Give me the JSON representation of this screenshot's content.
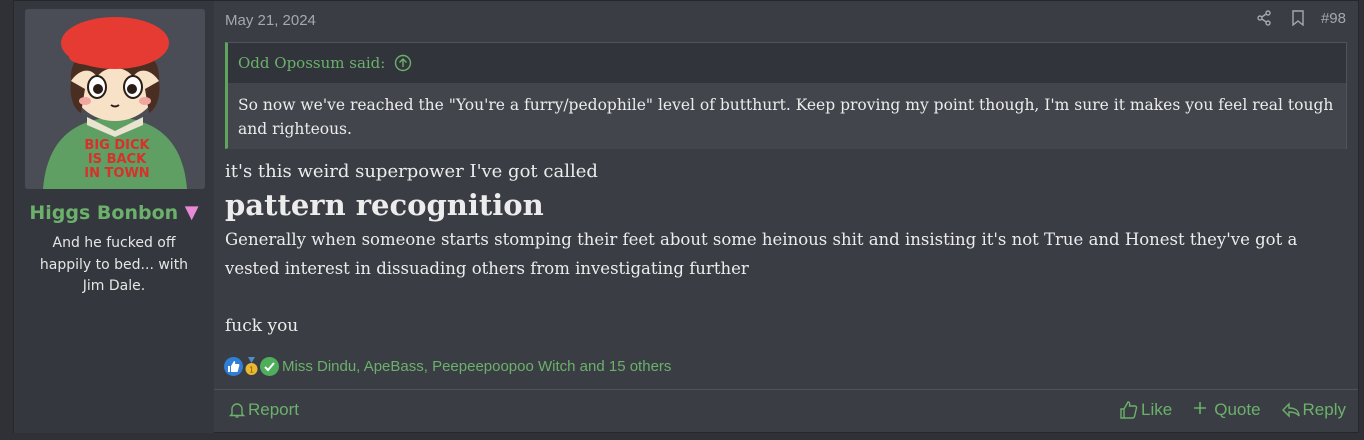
{
  "post": {
    "date": "May 21, 2024",
    "number": "#98",
    "icons": {
      "share": "share-icon",
      "bookmark": "bookmark-icon"
    }
  },
  "user": {
    "name": "Higgs Bonbon",
    "title": "And he fucked off happily to bed... with Jim Dale.",
    "avatar_text": [
      "BIG DICK",
      "IS BACK",
      "IN TOWN"
    ],
    "colors": {
      "name": "#6bb06b",
      "badge": "#e889d6"
    }
  },
  "quote": {
    "author": "Odd Opossum said:",
    "text": "So now we've reached the \"You're a furry/pedophile\" level of butthurt. Keep proving my point though, I'm sure it makes you feel real tough and righteous."
  },
  "body": {
    "line1": "it's this weird superpower I've got called",
    "big": "pattern recognition",
    "line2": "Generally when someone starts stomping their feet about some heinous shit and insisting it's not True and Honest they've got a vested interest in dissuading others from investigating further",
    "line3": "fuck you"
  },
  "reactions": {
    "icons": [
      "like-icon",
      "winner-icon",
      "agree-icon"
    ],
    "text": "Miss Dindu, ApeBass, Peepeepoopoo Witch and 15 others"
  },
  "footer": {
    "report": "Report",
    "like": "Like",
    "quote": "Quote",
    "reply": "Reply"
  },
  "colors": {
    "accent": "#6bb06b",
    "background": "#3a3d44",
    "sidebar": "#34373d"
  }
}
